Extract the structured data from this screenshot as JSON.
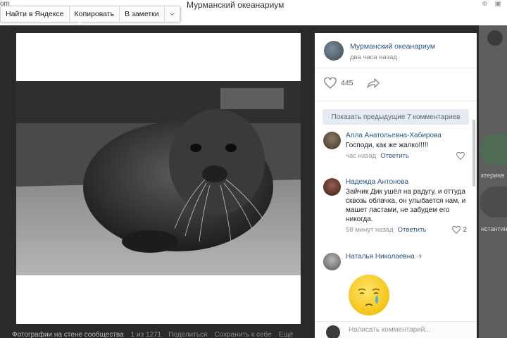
{
  "browser": {
    "url_fragment": "om",
    "page_title": "Мурманский океанариум"
  },
  "selection_toolbar": {
    "search_label": "Найти в Яндексе",
    "copy_label": "Копировать",
    "notes_label": "В заметки",
    "more_icon": "chevron-down-icon"
  },
  "viewer": {
    "caption": "Фотографии на стене сообщества",
    "counter": "1 из 1271",
    "share_label": "Поделиться",
    "save_label": "Сохранить к себе",
    "more_label": "Ещё"
  },
  "side": {
    "name_1": "ктерина",
    "name_2": "нстантин"
  },
  "post": {
    "group_name": "Мурманский океанариум",
    "time": "два часа назад",
    "likes": "445"
  },
  "comments": {
    "show_previous": "Показать предыдущие 7 комментариев",
    "items": [
      {
        "author": "Алла Анатольевна-Хабирова",
        "text": "Господи, как же жалко!!!!!",
        "time": "час назад",
        "reply_label": "Ответить",
        "likes": ""
      },
      {
        "author": "Надежда Антонова",
        "text": "Зайчик Дик ушёл на радугу, и оттуда сквозь облачка, он улыбается нам, и машет ластами, не забудем его никогда.",
        "time": "58 минут назад",
        "reply_label": "Ответить",
        "likes": "2"
      },
      {
        "author": "Наталья Николаевна",
        "text": "",
        "time": "",
        "reply_label": "",
        "likes": ""
      }
    ]
  },
  "input": {
    "placeholder": "Написать комментарий..."
  },
  "colors": {
    "link": "#2a5885",
    "viewer_dark": "#2a2a2a",
    "button_bg": "#e5ebf1"
  }
}
